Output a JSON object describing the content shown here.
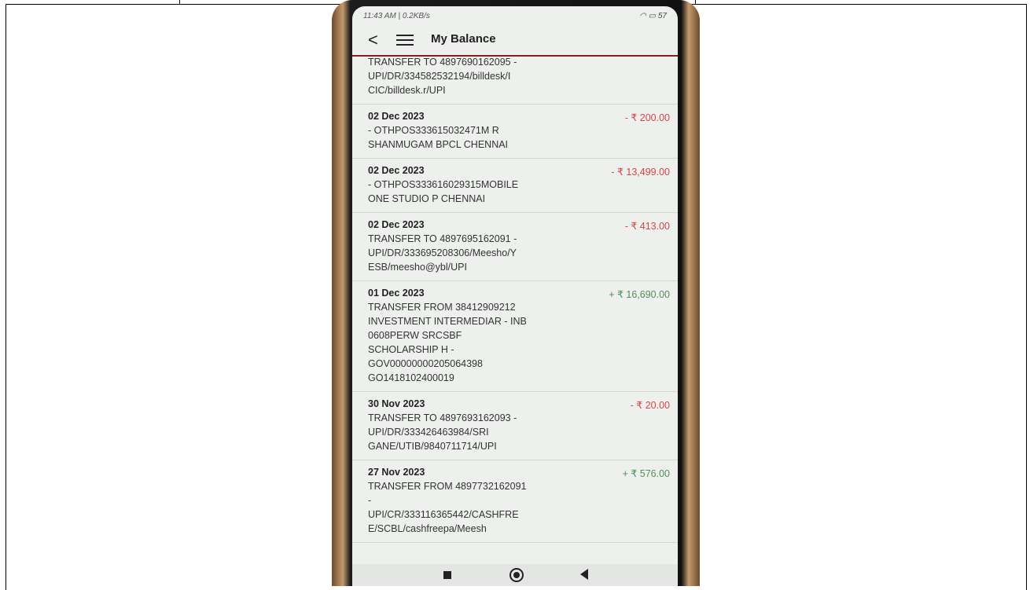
{
  "statusbar": {
    "time": "11:43 AM | 0.2KB/s",
    "battery": "57"
  },
  "appbar": {
    "back_glyph": "<",
    "title": "My Balance"
  },
  "transactions": [
    {
      "date": "",
      "amount": "",
      "type": "debit",
      "desc": "TRANSFER TO 4897690162095 -\nUPI/DR/334582532194/billdesk/I\nCIC/billdesk.r/UPI"
    },
    {
      "date": "02 Dec 2023",
      "amount": "- ₹ 200.00",
      "type": "debit",
      "desc": "- OTHPOS333615032471M R\nSHANMUGAM BPCL CHENNAI"
    },
    {
      "date": "02 Dec 2023",
      "amount": "- ₹ 13,499.00",
      "type": "debit",
      "desc": "- OTHPOS333616029315MOBILE\nONE STUDIO P CHENNAI"
    },
    {
      "date": "02 Dec 2023",
      "amount": "- ₹ 413.00",
      "type": "debit",
      "desc": "TRANSFER TO 4897695162091 -\nUPI/DR/333695208306/Meesho/Y\nESB/meesho@ybl/UPI"
    },
    {
      "date": "01 Dec 2023",
      "amount": "+ ₹ 16,690.00",
      "type": "credit",
      "desc": "TRANSFER FROM 38412909212\nINVESTMENT INTERMEDIAR - INB\n0608PERW SRCSBF\nSCHOLARSHIP H -\nGOV00000000205064398\nGO1418102400019"
    },
    {
      "date": "30 Nov 2023",
      "amount": "- ₹ 20.00",
      "type": "debit",
      "desc": "TRANSFER TO 4897693162093 -\nUPI/DR/333426463984/SRI\nGANE/UTIB/9840711714/UPI"
    },
    {
      "date": "27 Nov 2023",
      "amount": "+ ₹ 576.00",
      "type": "credit",
      "desc": "TRANSFER FROM 4897732162091\n-\nUPI/CR/333116365442/CASHFRE\nE/SCBL/cashfreepa/Meesh"
    }
  ],
  "colors": {
    "debit": "#d64545",
    "credit": "#4f8f5a",
    "appbar_underline": "#8b1d1d"
  }
}
